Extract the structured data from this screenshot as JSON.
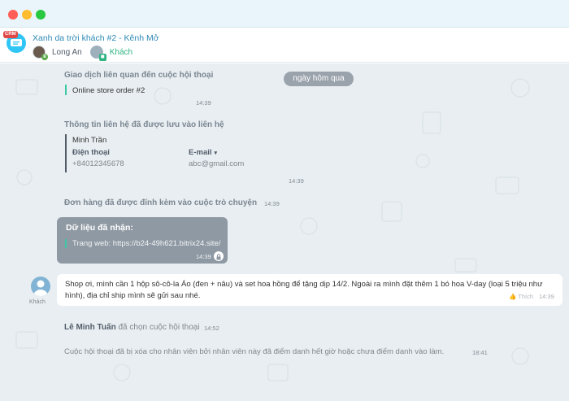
{
  "window": {
    "controls": [
      "close",
      "minimize",
      "maximize"
    ]
  },
  "header": {
    "badge": "CRM",
    "title": "Xanh da trời khách #2 - Kênh Mở",
    "participants": [
      {
        "name": "Long An",
        "icon": "user-avatar-icon"
      },
      {
        "name": "Khách",
        "icon": "guest-avatar-icon",
        "color": "#2fb383"
      }
    ]
  },
  "chat": {
    "date_separator": "ngày hôm qua",
    "transaction": {
      "title": "Giao dịch liên quan đến cuộc hội thoại",
      "item": "Online store order #2",
      "time": "14:39"
    },
    "contact_saved": {
      "title": "Thông tin liên hệ đã được lưu vào liên hệ",
      "name": "Minh Trần",
      "phone_label": "Điện thoại",
      "phone_value": "+84012345678",
      "email_label": "E-mail",
      "email_value": "abc@gmail.com",
      "time": "14:39"
    },
    "order_attached": {
      "title": "Đơn hàng đã được đính kèm vào cuộc trò chuyện",
      "time": "14:39"
    },
    "form_data": {
      "title": "Dữ liệu đã nhận:",
      "link": "Trang web: https://b24-49h621.bitrix24.site/",
      "time": "14:39"
    },
    "guest_message": {
      "author": "Khách",
      "text": "Shop ơi, mình cần 1 hộp sô-cô-la Áo (đen + nâu) và set hoa hồng để tặng dịp 14/2. Ngoài ra mình đặt thêm 1 bó hoa V-day (loại 5 triệu như hình), địa chỉ ship mình sẽ gửi sau nhé.",
      "like": "Thích",
      "time": "14:39"
    },
    "operator_took": {
      "name": "Lê Minh Tuấn",
      "action": "đã chọn cuộc hội thoại",
      "time": "14:52"
    },
    "conversation_hidden": {
      "text": "Cuộc hội thoại đã bị xóa cho nhân viên bởi nhân viên này đã điểm danh hết giờ hoặc chưa điểm danh vào làm.",
      "time": "18:41"
    }
  },
  "colors": {
    "accent": "#2e8ab4",
    "quote": "#3bc8a5",
    "chat_bg": "#e8eef1",
    "form_bubble": "#8f99a3"
  }
}
